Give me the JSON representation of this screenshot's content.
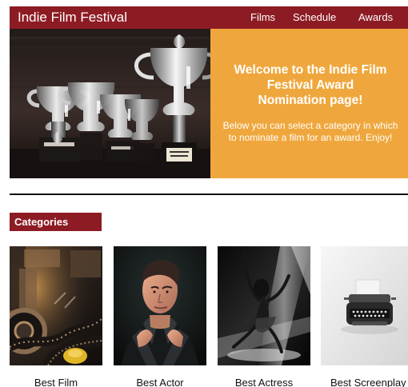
{
  "header": {
    "brand": "Indie Film Festival",
    "nav": [
      {
        "label": "Films"
      },
      {
        "label": "Schedule"
      },
      {
        "label": "Awards"
      }
    ]
  },
  "hero": {
    "title": "Welcome to the Indie Film Festival Award Nomination page!",
    "body": "Below you can select a category in which to nominate a film for an award. Enjoy!"
  },
  "categories": {
    "heading": "Categories",
    "items": [
      {
        "label": "Best Film"
      },
      {
        "label": "Best Actor"
      },
      {
        "label": "Best Actress"
      },
      {
        "label": "Best Screenplay"
      }
    ]
  },
  "colors": {
    "brand": "#8d1b23",
    "accent": "#efa73d",
    "text": "#111111"
  },
  "icons": {
    "hero_image": "trophies-image",
    "film_image": "film-reel-image",
    "actor_image": "actor-portrait-image",
    "actress_image": "dancer-image",
    "screenplay_image": "typewriter-image"
  }
}
